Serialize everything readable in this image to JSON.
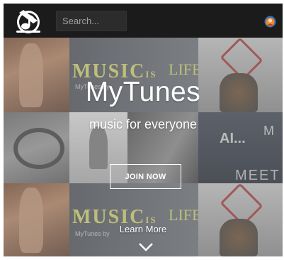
{
  "navbar": {
    "logo_icon": "music-note-logo-icon",
    "search": {
      "placeholder": "Search...",
      "value": ""
    },
    "avatar_icon": "user-avatar-icon"
  },
  "hero": {
    "title": "MyTunes",
    "subtitle": "music for everyone",
    "join_button": "JOIN NOW",
    "learn_more": "Learn More",
    "chevron_icon": "chevron-down-icon"
  },
  "collage": {
    "tile_text_music": "MUSIC",
    "tile_text_is": "IS",
    "tile_text_life": "LIFE",
    "tile_text_mytunes": "MyTunes by",
    "tile_text_meet": "MEET",
    "tile_text_ai": "AI...",
    "tile_text_m": "M"
  },
  "colors": {
    "navbar_bg": "#1b1b1b",
    "accent_white": "#ffffff",
    "overlay": "rgba(150,150,150,0.38)"
  }
}
